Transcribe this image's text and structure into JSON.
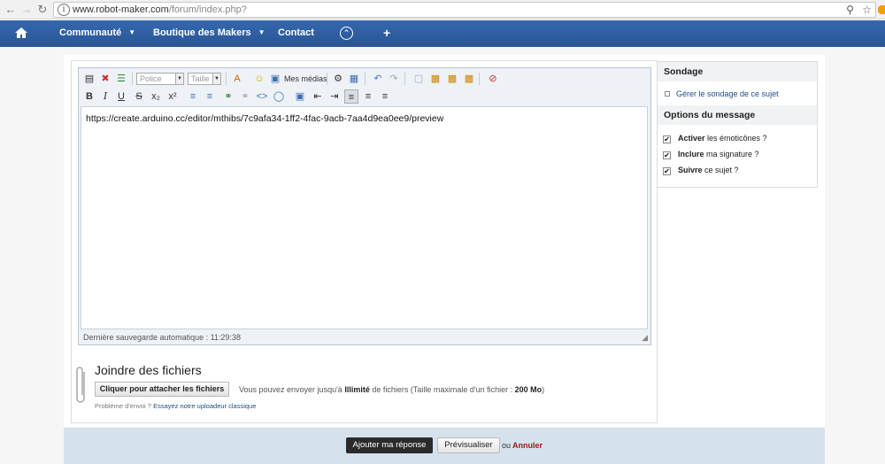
{
  "browser": {
    "url_domain": "www.robot-maker.com",
    "url_path": "/forum/index.php?"
  },
  "nav": {
    "items": [
      {
        "label": "Communauté"
      },
      {
        "label": "Boutique des Makers"
      },
      {
        "label": "Contact"
      }
    ]
  },
  "toolbar": {
    "font_select": "Police",
    "size_select": "Taille",
    "media_label": "Mes médias"
  },
  "editor": {
    "content": "https://create.arduino.cc/editor/mthibs/7c9afa34-1ff2-4fac-9acb-7aa4d9ea0ee9/preview",
    "autosave": "Dernière sauvegarde automatique : 11:29:38"
  },
  "sidebar": {
    "poll_title": "Sondage",
    "poll_link": "Gérer le sondage de ce sujet",
    "options_title": "Options du message",
    "options": [
      {
        "bold": "Activer",
        "rest": " les émoticônes ?",
        "checked": true
      },
      {
        "bold": "Inclure",
        "rest": " ma signature ?",
        "checked": true
      },
      {
        "bold": "Suivre",
        "rest": " ce sujet ?",
        "checked": true
      }
    ]
  },
  "attachments": {
    "title": "Joindre des fichiers",
    "button": "Cliquer pour attacher les fichiers",
    "info_a": "Vous pouvez envoyer jusqu'à ",
    "info_b": "Illimité",
    "info_c": " de fichiers (Taille maximale d'un fichier : ",
    "info_d": "200 Mo",
    "info_e": ")",
    "problem_text": "Problème d'envoi ? ",
    "problem_link": "Essayez notre uploadeur classique"
  },
  "footer": {
    "submit": "Ajouter ma réponse",
    "preview": "Prévisualiser",
    "or": "ou",
    "cancel": "Annuler"
  },
  "colors": {
    "nav_bg": "#2f5ea3",
    "footer_bg": "#d6e1ee",
    "cancel": "#a11818",
    "link": "#1d4d84"
  }
}
